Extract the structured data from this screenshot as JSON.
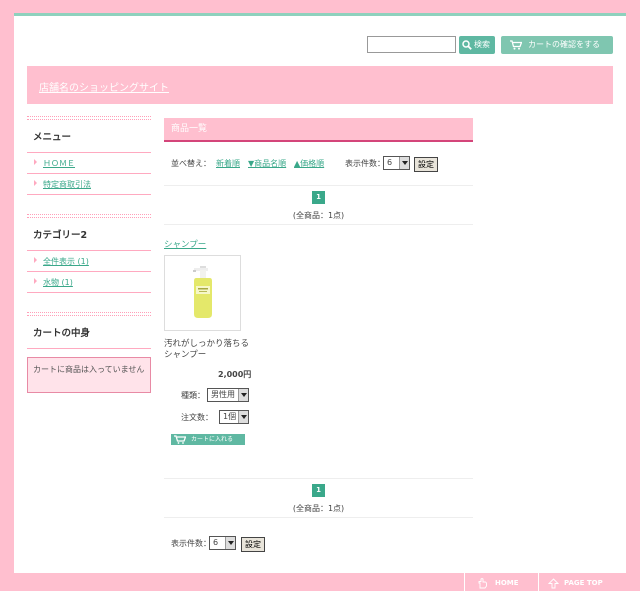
{
  "header": {
    "search_placeholder": "",
    "search_button": "検索",
    "cart_button": "カートの確認をする",
    "shop_name": "店舗名のショッピングサイト"
  },
  "sidebar": {
    "menu_title": "メニュー",
    "menu_items": [
      {
        "label": "ＨＯＭＥ"
      },
      {
        "label": "特定商取引法"
      }
    ],
    "category_title": "カテゴリー2",
    "category_items": [
      {
        "label": "全件表示 (1)"
      },
      {
        "label": "水物 (1)"
      }
    ],
    "cart_title": "カートの中身",
    "cart_empty": "カートに商品は入っていません"
  },
  "main": {
    "title": "商品一覧",
    "sort_label": "並べ替え：",
    "sort_options": [
      "新着順",
      "▼商品名順",
      "▲価格順"
    ],
    "count_label": "表示件数：",
    "count_value": "6",
    "set_button": "設定",
    "page_current": "1",
    "total_text": "(全商品：1点)"
  },
  "product": {
    "name": "シャンプー",
    "description_line1": "汚れがしっかり落ちる",
    "description_line2": "シャンプー",
    "price": "2,000円",
    "kind_label": "種類：",
    "kind_value": "男性用",
    "qty_label": "注文数：",
    "qty_value": "1個",
    "add_cart_label": "カートに入れる"
  },
  "footer": {
    "home_label": "HOME",
    "top_label": "PAGE TOP"
  },
  "colors": {
    "pink": "#ffbfcf",
    "teal": "#3aa88a",
    "accent_line": "#d4457a"
  }
}
